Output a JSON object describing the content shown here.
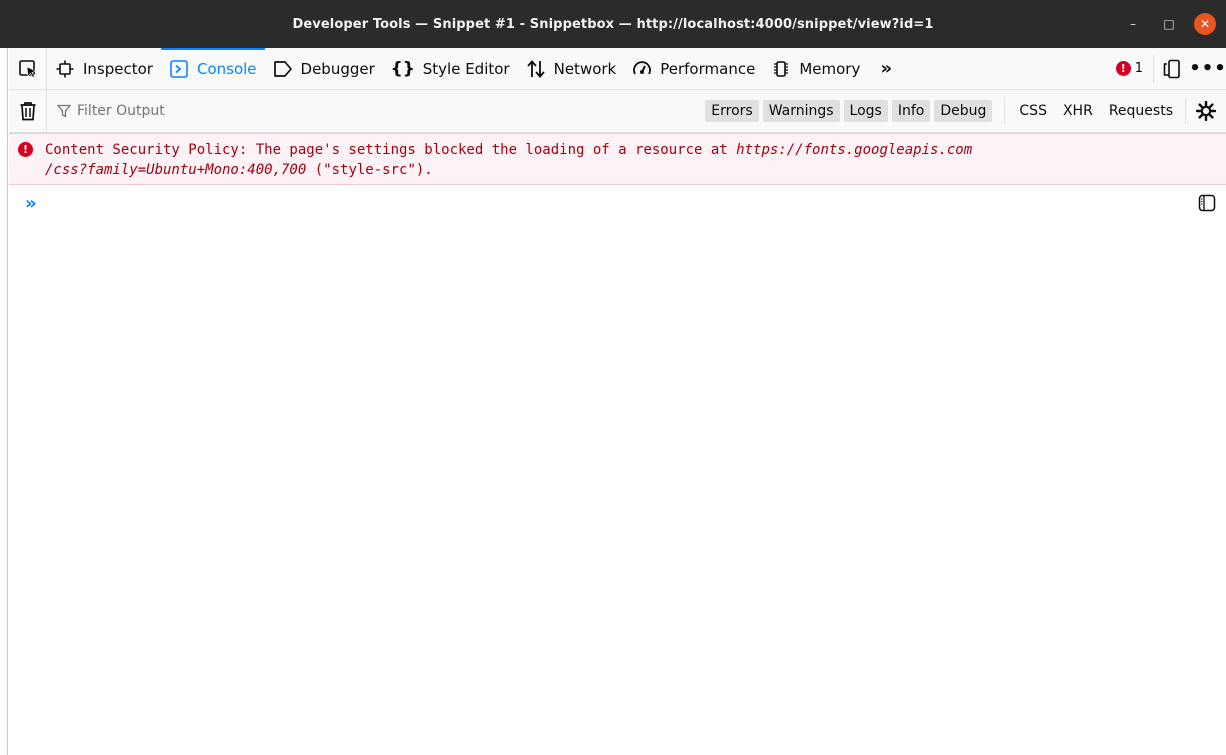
{
  "window": {
    "title": "Developer Tools — Snippet #1 - Snippetbox — http://localhost:4000/snippet/view?id=1",
    "minimize_icon": "minimize-icon",
    "maximize_icon": "maximize-icon",
    "close_icon": "close-icon"
  },
  "toolbar": {
    "tabs": [
      {
        "label": "Inspector",
        "icon": "inspector-icon"
      },
      {
        "label": "Console",
        "icon": "console-icon",
        "selected": true
      },
      {
        "label": "Debugger",
        "icon": "debugger-icon"
      },
      {
        "label": "Style Editor",
        "icon": "braces-icon"
      },
      {
        "label": "Network",
        "icon": "network-arrows-icon"
      },
      {
        "label": "Performance",
        "icon": "gauge-icon"
      },
      {
        "label": "Memory",
        "icon": "memory-chip-icon"
      }
    ],
    "error_count": "1",
    "accent_color": "#0a84ff",
    "error_color": "#d70022"
  },
  "filterbar": {
    "placeholder": "Filter Output",
    "levels": [
      "Errors",
      "Warnings",
      "Logs",
      "Info",
      "Debug"
    ],
    "categories": [
      "CSS",
      "XHR",
      "Requests"
    ]
  },
  "console": {
    "messages": [
      {
        "type": "error",
        "text_prefix": "Content Security Policy: The page's settings blocked the loading of a resource at ",
        "url_line1": "https://fonts.googleapis.com",
        "url_line2": "/css?family=Ubuntu+Mono:400,700",
        "text_suffix": " (\"style-src\")."
      }
    ]
  }
}
